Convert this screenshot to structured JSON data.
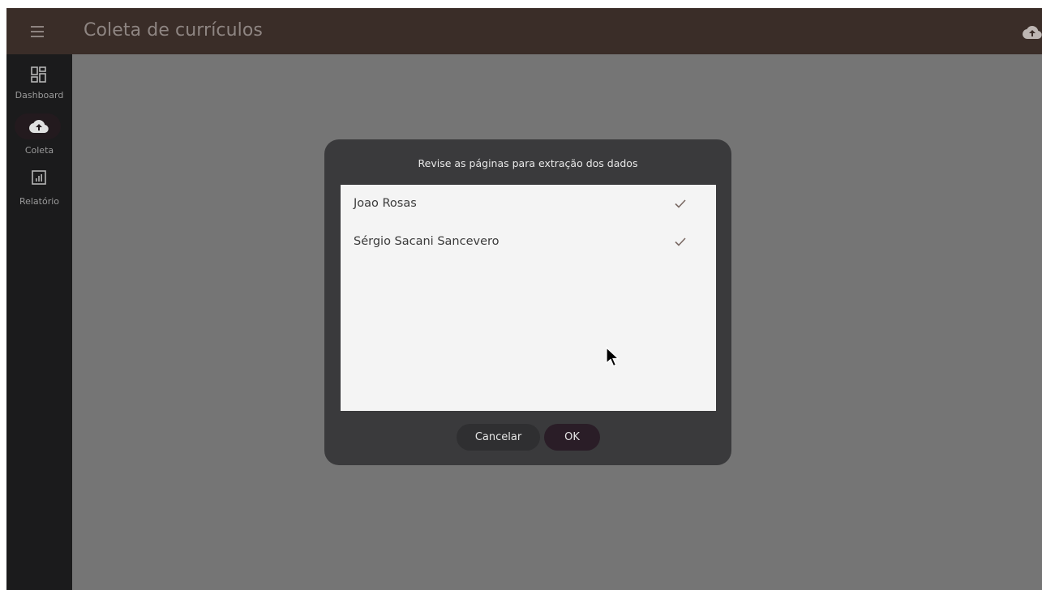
{
  "appbar": {
    "title": "Coleta de currículos",
    "menu_icon": "hamburger-menu-icon",
    "upload_icon": "cloud-upload-icon"
  },
  "sidebar": {
    "items": [
      {
        "label": "Dashboard",
        "icon": "dashboard-grid-icon",
        "active": false
      },
      {
        "label": "Coleta",
        "icon": "cloud-upload-icon",
        "active": true
      },
      {
        "label": "Relatório",
        "icon": "report-chart-icon",
        "active": false
      }
    ]
  },
  "dialog": {
    "title": "Revise as páginas para extração dos dados",
    "items": [
      {
        "label": "Joao Rosas",
        "checked": true
      },
      {
        "label": "Sérgio Sacani Sancevero",
        "checked": true
      }
    ],
    "cancel_label": "Cancelar",
    "ok_label": "OK"
  },
  "colors": {
    "appbar": "#3a2d28",
    "sidebar": "#1b1b1c",
    "scrim": "#757575",
    "dialog": "#3a3a3c",
    "list_bg": "#f4f4f4"
  }
}
